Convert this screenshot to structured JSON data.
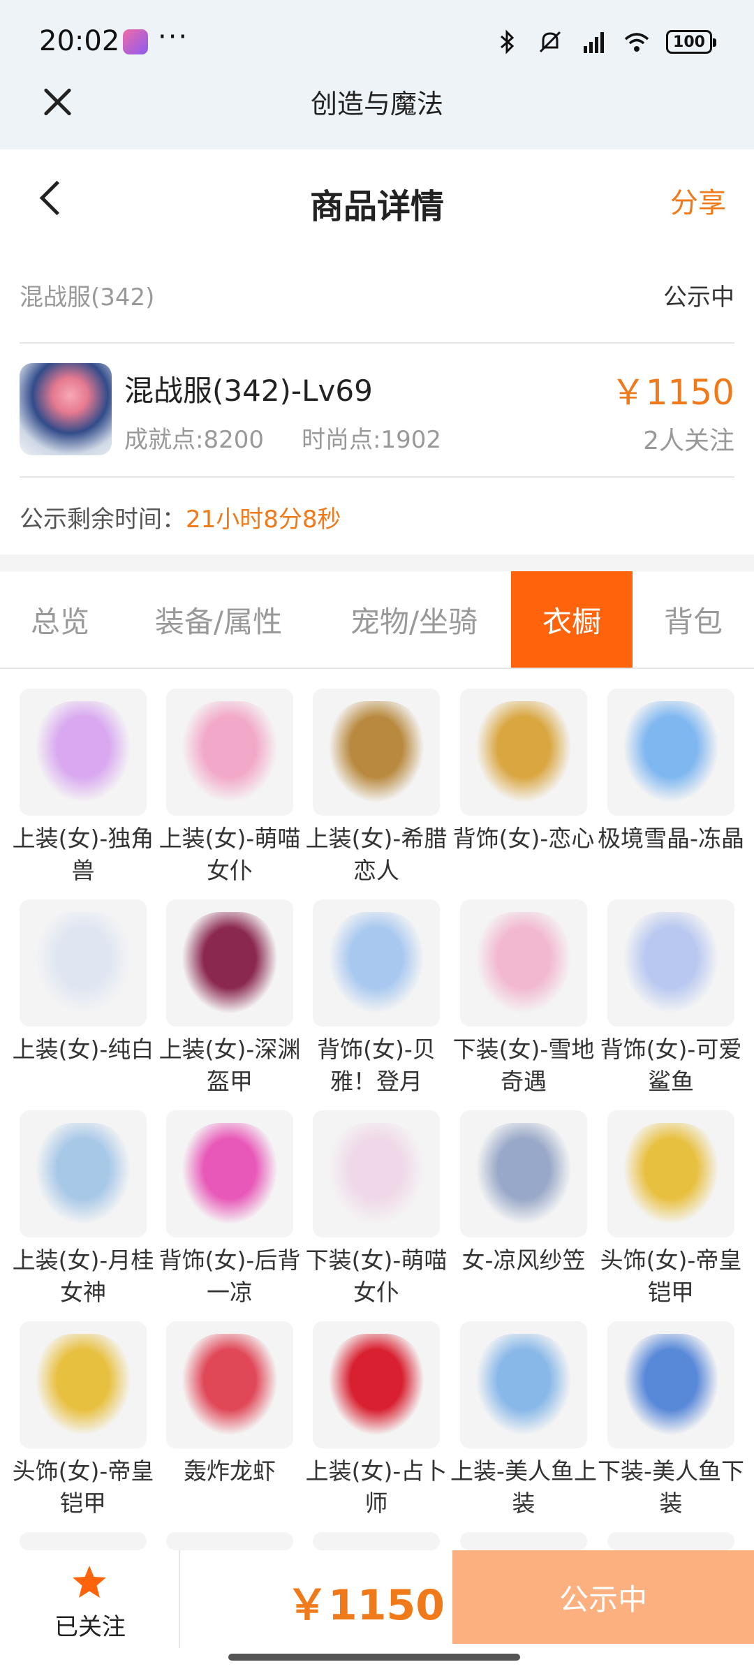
{
  "status_bar": {
    "time": "20:02",
    "more": "···",
    "battery": "100"
  },
  "web_header": {
    "title": "创造与魔法"
  },
  "page_header": {
    "title": "商品详情",
    "share": "分享"
  },
  "item": {
    "server": "混战服(342)",
    "status": "公示中",
    "title": "混战服(342)-Lv69",
    "achievement": "成就点:8200",
    "fashion": "时尚点:1902",
    "price": "￥1150",
    "followers": "2人关注",
    "countdown_label": "公示剩余时间：",
    "countdown_value": "21小时8分8秒"
  },
  "tabs": [
    {
      "label": "总览"
    },
    {
      "label": "装备/属性"
    },
    {
      "label": "宠物/坐骑"
    },
    {
      "label": "衣橱"
    },
    {
      "label": "背包"
    }
  ],
  "active_tab": "衣橱",
  "wardrobe": [
    {
      "label": "上装(女)-独角兽",
      "icon": "unicorn-top-icon",
      "color": "#d9a8f0"
    },
    {
      "label": "上装(女)-萌喵女仆",
      "icon": "maid-dress-icon",
      "color": "#f2a8c8"
    },
    {
      "label": "上装(女)-希腊恋人",
      "icon": "greek-dress-icon",
      "color": "#b8893e"
    },
    {
      "label": "背饰(女)-恋心",
      "icon": "heart-wand-icon",
      "color": "#d9a640"
    },
    {
      "label": "极境雪晶-冻晶",
      "icon": "ice-sword-icon",
      "color": "#7fb7f0"
    },
    {
      "label": "上装(女)-纯白",
      "icon": "white-dress-icon",
      "color": "#dfe6f2"
    },
    {
      "label": "上装(女)-深渊盔甲",
      "icon": "abyss-armor-icon",
      "color": "#8a2850"
    },
    {
      "label": "背饰(女)-贝雅！登月",
      "icon": "bunny-astronaut-icon",
      "color": "#a8c8f0"
    },
    {
      "label": "下装(女)-雪地奇遇",
      "icon": "snow-boots-icon",
      "color": "#f2b8d0"
    },
    {
      "label": "背饰(女)-可爱鲨鱼",
      "icon": "cute-shark-icon",
      "color": "#b8c8f0"
    },
    {
      "label": "上装(女)-月桂女神",
      "icon": "laurel-top-icon",
      "color": "#a8c8e8"
    },
    {
      "label": "背饰(女)-后背一凉",
      "icon": "ice-cream-icon",
      "color": "#e858b8"
    },
    {
      "label": "下装(女)-萌喵女仆",
      "icon": "maid-stockings-icon",
      "color": "#f0d8e8"
    },
    {
      "label": "女-凉风纱笠",
      "icon": "veil-hat-icon",
      "color": "#98a8c8"
    },
    {
      "label": "头饰(女)-帝皇铠甲",
      "icon": "emperor-helmet-icon",
      "color": "#e8c040"
    },
    {
      "label": "头饰(女)-帝皇铠甲",
      "icon": "emperor-helmet-icon",
      "color": "#e8c040"
    },
    {
      "label": "轰炸龙虾",
      "icon": "lobster-icon",
      "color": "#e04858"
    },
    {
      "label": "上装(女)-占卜师",
      "icon": "fortune-dress-icon",
      "color": "#d82030"
    },
    {
      "label": "上装-美人鱼上装",
      "icon": "mermaid-top-icon",
      "color": "#88b8e8"
    },
    {
      "label": "下装-美人鱼下装",
      "icon": "mermaid-skirt-icon",
      "color": "#5888d8"
    }
  ],
  "bottom_bar": {
    "follow_label": "已关注",
    "price": "￥1150",
    "action": "公示中"
  },
  "colors": {
    "accent": "#ff640d",
    "price": "#f07a1a",
    "action_button": "#fdb07f"
  }
}
